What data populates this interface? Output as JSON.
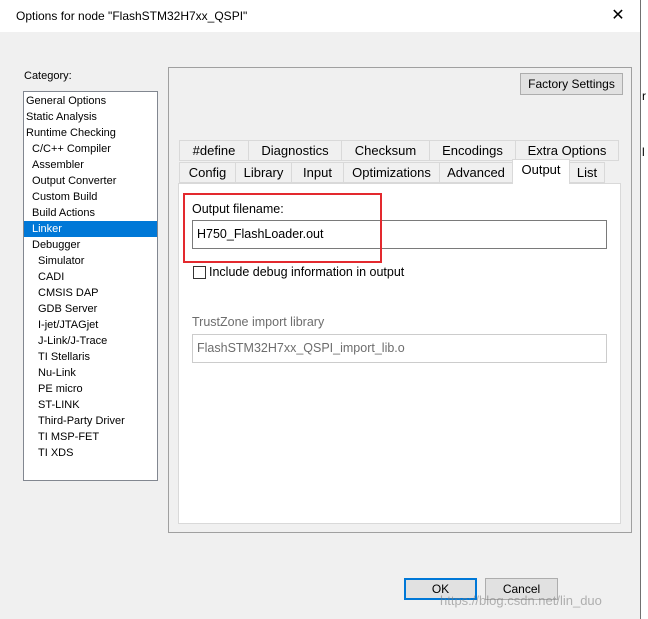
{
  "window": {
    "title": "Options for node \"FlashSTM32H7xx_QSPI\"",
    "close_glyph": "✕"
  },
  "category": {
    "label": "Category:",
    "items": [
      {
        "label": "General Options",
        "level": 0
      },
      {
        "label": "Static Analysis",
        "level": 0
      },
      {
        "label": "Runtime Checking",
        "level": 0
      },
      {
        "label": "C/C++ Compiler",
        "level": 1
      },
      {
        "label": "Assembler",
        "level": 1
      },
      {
        "label": "Output Converter",
        "level": 1
      },
      {
        "label": "Custom Build",
        "level": 1
      },
      {
        "label": "Build Actions",
        "level": 1
      },
      {
        "label": "Linker",
        "level": 1,
        "selected": true
      },
      {
        "label": "Debugger",
        "level": 1
      },
      {
        "label": "Simulator",
        "level": 2
      },
      {
        "label": "CADI",
        "level": 2
      },
      {
        "label": "CMSIS DAP",
        "level": 2
      },
      {
        "label": "GDB Server",
        "level": 2
      },
      {
        "label": "I-jet/JTAGjet",
        "level": 2
      },
      {
        "label": "J-Link/J-Trace",
        "level": 2
      },
      {
        "label": "TI Stellaris",
        "level": 2
      },
      {
        "label": "Nu-Link",
        "level": 2
      },
      {
        "label": "PE micro",
        "level": 2
      },
      {
        "label": "ST-LINK",
        "level": 2
      },
      {
        "label": "Third-Party Driver",
        "level": 2
      },
      {
        "label": "TI MSP-FET",
        "level": 2
      },
      {
        "label": "TI XDS",
        "level": 2
      }
    ]
  },
  "factory_settings_label": "Factory Settings",
  "tabs_row1": [
    "#define",
    "Diagnostics",
    "Checksum",
    "Encodings",
    "Extra Options"
  ],
  "tabs_row2": [
    "Config",
    "Library",
    "Input",
    "Optimizations",
    "Advanced",
    "Output",
    "List"
  ],
  "active_tab": "Output",
  "output": {
    "filename_label": "Output filename:",
    "filename_value": "H750_FlashLoader.out",
    "debug_label": "Include debug information in output",
    "debug_checked": false,
    "trustzone_label": "TrustZone import library",
    "trustzone_value": "FlashSTM32H7xx_QSPI_import_lib.o"
  },
  "buttons": {
    "ok": "OK",
    "cancel": "Cancel"
  },
  "watermark": "https://blog.csdn.net/lin_duo",
  "background_fragments": [
    "r",
    "l"
  ],
  "colors": {
    "selection": "#0078d7",
    "highlight_box": "#e3292e"
  }
}
